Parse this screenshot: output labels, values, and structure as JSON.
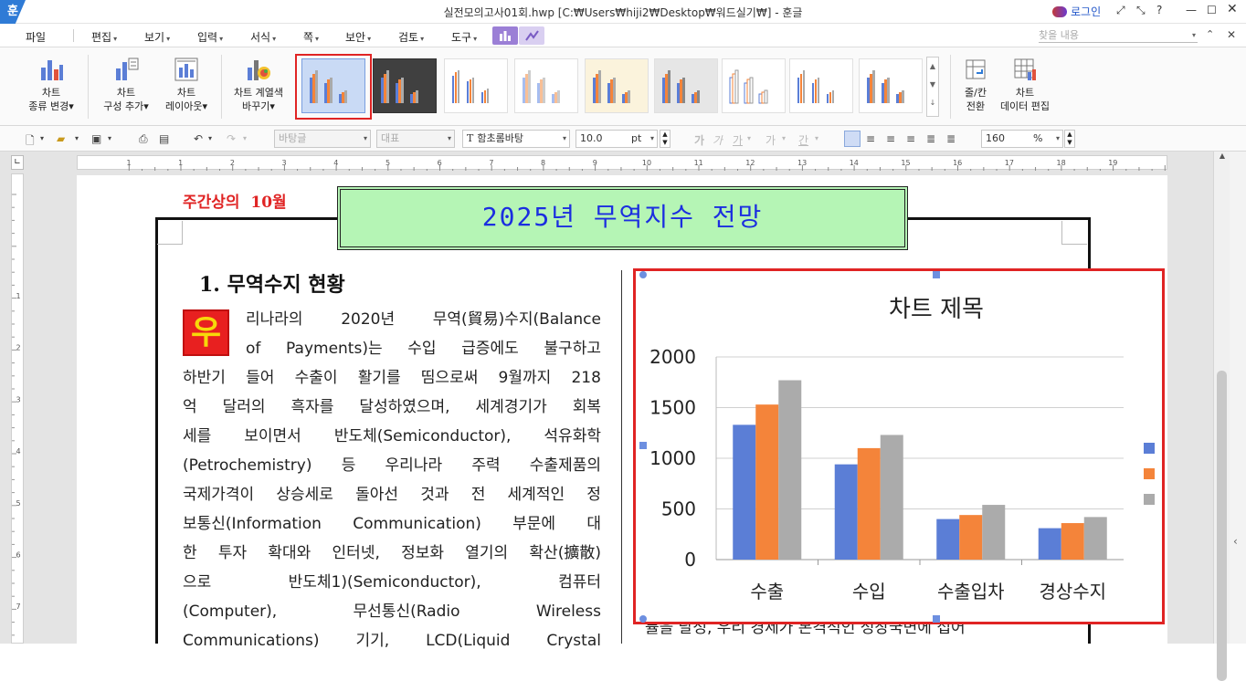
{
  "window": {
    "title": "실전모의고사01회.hwp [C:₩Users₩hiji2₩Desktop₩워드실기₩] - 훈글",
    "logo": "훈",
    "login": "로그인",
    "help": "?"
  },
  "menu": {
    "items": [
      "파일",
      "편집",
      "보기",
      "입력",
      "서식",
      "쪽",
      "보안",
      "검토",
      "도구"
    ],
    "search_placeholder": "찾을 내용"
  },
  "ribbon": {
    "chart_type": [
      "차트",
      "종류 변경"
    ],
    "add_element": [
      "차트",
      "구성 추가"
    ],
    "layout": [
      "차트",
      "레이아웃"
    ],
    "color_series": [
      "차트 계열색",
      "바꾸기"
    ],
    "row_col": [
      "줄/칸",
      "전환"
    ],
    "data_edit": [
      "차트",
      "데이터 편집"
    ]
  },
  "format": {
    "style": "바탕글",
    "outline": "대표",
    "font": "함초롬바탕",
    "size": "10.0",
    "size_unit": "pt",
    "zoom": "160",
    "zoom_unit": "%"
  },
  "ruler": {
    "h_marks": [
      "1",
      "1",
      "2",
      "3",
      "4",
      "5",
      "6",
      "7",
      "8",
      "9",
      "10",
      "11",
      "12",
      "13",
      "14",
      "15",
      "16",
      "17",
      "18",
      "19"
    ],
    "v_marks": [
      "1",
      "2",
      "3",
      "4",
      "5",
      "6",
      "7"
    ]
  },
  "document": {
    "header_label": "주간상의  10월",
    "title": "2025년 무역지수 전망",
    "section_heading": "1. 무역수지 현황",
    "dropcap": "우",
    "line1_first": "리나라의 2020년 무역(貿易)수지(Balance",
    "line2_first": "of Payments)는 수입 급증에도 불구하고",
    "lines": [
      "하반기 들어 수출이 활기를 띰으로써 9월까지 218",
      "억 달러의 흑자를 달성하였으며, 세계경기가 회복",
      "세를 보이면서 반도체(Semiconductor), 석유화학",
      "(Petrochemistry) 등 우리나라 주력 수출제품의",
      "국제가격이 상승세로 돌아선 것과 전 세계적인 정",
      "보통신(Information Communication) 부문에 대",
      "한 투자 확대와 인터넷, 정보화 열기의 확산(擴散)",
      "으로  반도체1)(Semiconductor),  컴퓨터",
      "(Computer),  무선통신(Radio  Wireless",
      "Communications) 기기, LCD(Liquid Crystal"
    ],
    "right_bottom_text": "률을 달성, 우리 경제가 본격적인 성장국면에 접어"
  },
  "chart_data": {
    "type": "bar",
    "title": "차트 제목",
    "categories": [
      "수출",
      "수입",
      "수출입차",
      "경상수지"
    ],
    "series": [
      {
        "values": [
          1330,
          940,
          400,
          310
        ],
        "color": "#5b7ed6"
      },
      {
        "values": [
          1530,
          1100,
          440,
          360
        ],
        "color": "#f4843a"
      },
      {
        "values": [
          1770,
          1230,
          540,
          420
        ],
        "color": "#ababab"
      }
    ],
    "ylim": [
      0,
      2000
    ],
    "yticks": [
      "2000",
      "1500",
      "1000",
      "500",
      "0"
    ],
    "grid": true,
    "legend": "right"
  }
}
